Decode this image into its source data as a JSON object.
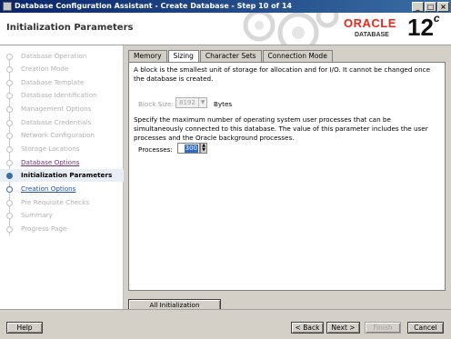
{
  "window": {
    "title": "Database Configuration Assistant - Create Database - Step 10 of 14"
  },
  "header": {
    "title": "Initialization Parameters",
    "oracle": "ORACLE",
    "database": "DATABASE",
    "version": "12",
    "version_suffix": "c"
  },
  "nav": {
    "items": [
      {
        "label": "Database Operation",
        "state": "disabled"
      },
      {
        "label": "Creation Mode",
        "state": "disabled"
      },
      {
        "label": "Database Template",
        "state": "disabled"
      },
      {
        "label": "Database Identification",
        "state": "disabled"
      },
      {
        "label": "Management Options",
        "state": "disabled"
      },
      {
        "label": "Database Credentials",
        "state": "disabled"
      },
      {
        "label": "Network Configuration",
        "state": "disabled"
      },
      {
        "label": "Storage Locations",
        "state": "disabled"
      },
      {
        "label": "Database Options",
        "state": "done"
      },
      {
        "label": "Initialization Parameters",
        "state": "current"
      },
      {
        "label": "Creation Options",
        "state": "next"
      },
      {
        "label": "Pre Requisite Checks",
        "state": "disabled"
      },
      {
        "label": "Summary",
        "state": "disabled"
      },
      {
        "label": "Progress Page",
        "state": "disabled"
      }
    ]
  },
  "tabs": [
    "Memory",
    "Sizing",
    "Character Sets",
    "Connection Mode"
  ],
  "sizing": {
    "block_desc": "A block is the smallest unit of storage for allocation and for I/O. It cannot be changed once the database is created.",
    "block_label": "Block Size:",
    "block_value": "8192",
    "block_unit": "Bytes",
    "proc_desc": "Specify the maximum number of operating system user processes that can be simultaneously connected to this database. The value of this parameter includes the user processes and the Oracle background processes.",
    "proc_label": "Processes:",
    "proc_value": "300"
  },
  "buttons": {
    "all_params": "All Initialization Parameters...",
    "help": "Help",
    "back": "< Back",
    "next": "Next >",
    "finish": "Finish",
    "cancel": "Cancel"
  }
}
